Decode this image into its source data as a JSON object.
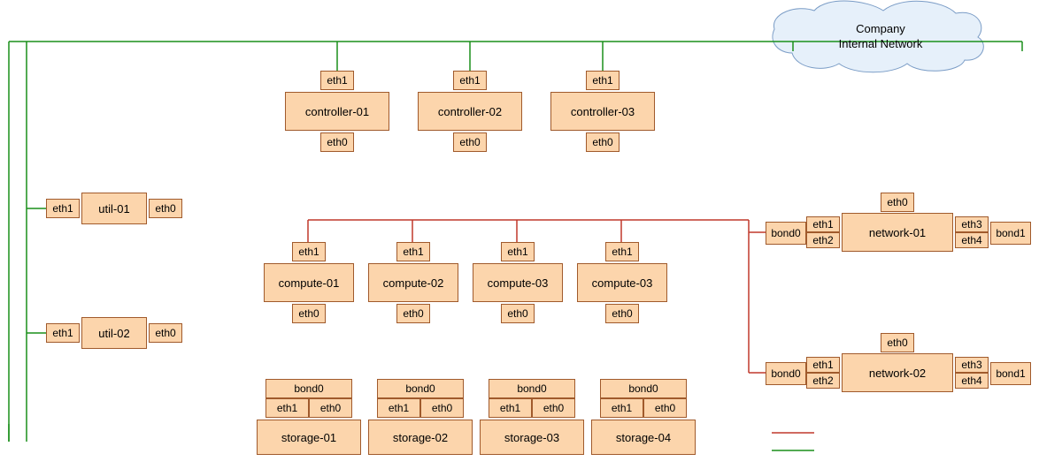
{
  "cloud": {
    "line1": "Company",
    "line2": "Internal Network"
  },
  "iface": {
    "eth0": "eth0",
    "eth1": "eth1",
    "eth2": "eth2",
    "eth3": "eth3",
    "eth4": "eth4",
    "bond0": "bond0",
    "bond1": "bond1"
  },
  "nodes": {
    "util01": "util-01",
    "util02": "util-02",
    "controller01": "controller-01",
    "controller02": "controller-02",
    "controller03": "controller-03",
    "compute01": "compute-01",
    "compute02": "compute-02",
    "compute03": "compute-03",
    "compute04": "compute-03",
    "storage01": "storage-01",
    "storage02": "storage-02",
    "storage03": "storage-03",
    "storage04": "storage-04",
    "network01": "network-01",
    "network02": "network-02"
  }
}
